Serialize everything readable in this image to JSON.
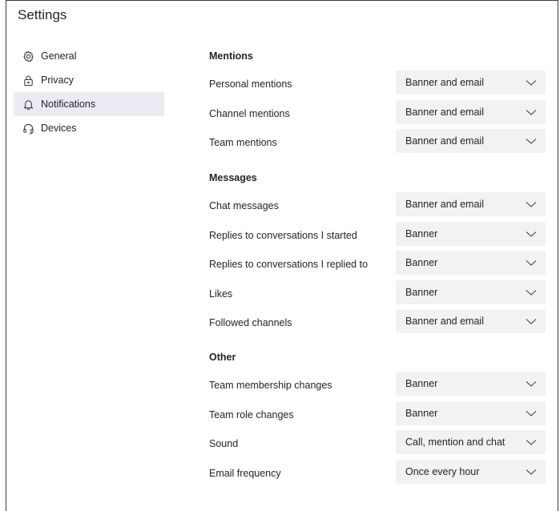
{
  "title": "Settings",
  "nav": [
    {
      "label": "General",
      "icon": "gear-icon"
    },
    {
      "label": "Privacy",
      "icon": "lock-icon"
    },
    {
      "label": "Notifications",
      "icon": "bell-icon",
      "active": true
    },
    {
      "label": "Devices",
      "icon": "headset-icon"
    }
  ],
  "sections": [
    {
      "heading": "Mentions",
      "rows": [
        {
          "label": "Personal mentions",
          "value": "Banner and email"
        },
        {
          "label": "Channel mentions",
          "value": "Banner and email"
        },
        {
          "label": "Team mentions",
          "value": "Banner and email"
        }
      ]
    },
    {
      "heading": "Messages",
      "rows": [
        {
          "label": "Chat messages",
          "value": "Banner and email"
        },
        {
          "label": "Replies to conversations I started",
          "value": "Banner"
        },
        {
          "label": "Replies to conversations I replied to",
          "value": "Banner"
        },
        {
          "label": "Likes",
          "value": "Banner"
        },
        {
          "label": "Followed channels",
          "value": "Banner and email"
        }
      ]
    },
    {
      "heading": "Other",
      "rows": [
        {
          "label": "Team membership changes",
          "value": "Banner"
        },
        {
          "label": "Team role changes",
          "value": "Banner"
        },
        {
          "label": "Sound",
          "value": "Call, mention and chat"
        },
        {
          "label": "Email frequency",
          "value": "Once every hour"
        }
      ]
    }
  ],
  "colors": {
    "active_nav_bg": "#ebebf3",
    "dropdown_bg": "#f3f2f1",
    "text": "#252423"
  }
}
